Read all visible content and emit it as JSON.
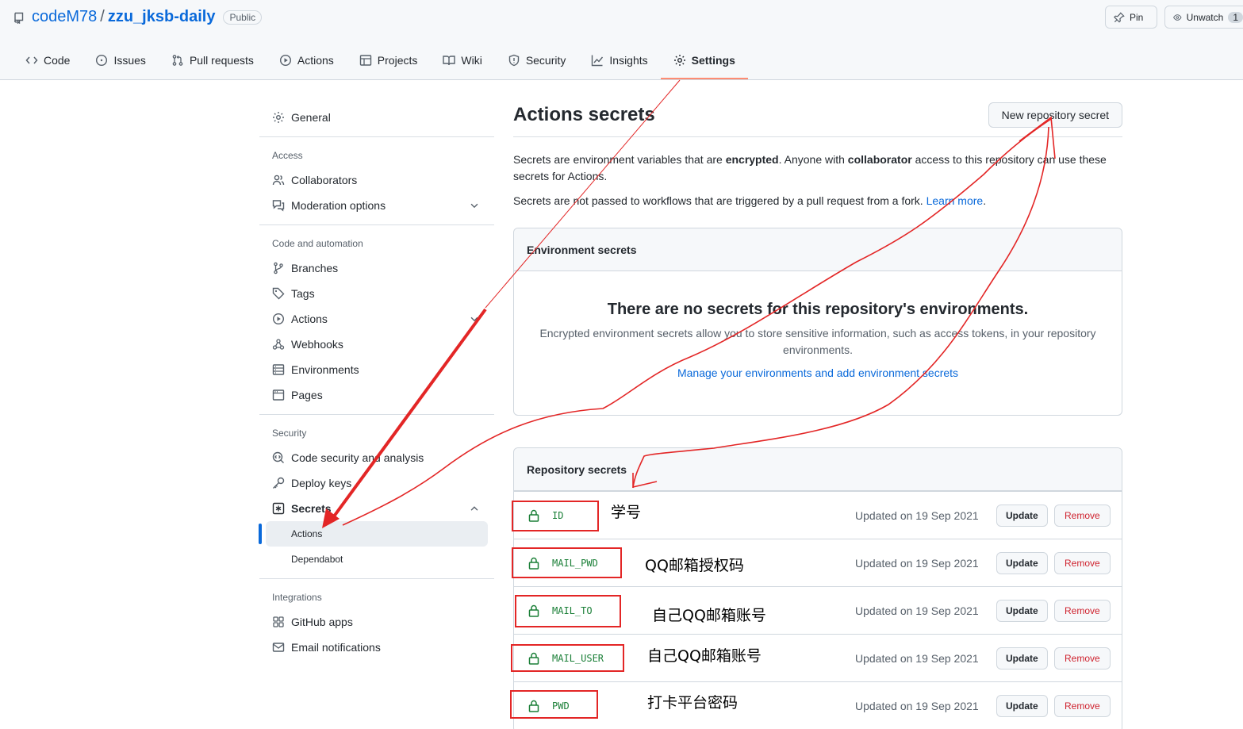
{
  "repo": {
    "owner": "codeM78",
    "separator": "/",
    "name": "zzu_jksb-daily",
    "visibility": "Public",
    "pin_label": "Pin",
    "watch_label": "Unwatch",
    "watch_count": "1"
  },
  "nav": {
    "tabs": [
      {
        "label": "Code",
        "icon": "code-icon"
      },
      {
        "label": "Issues",
        "icon": "issue-icon"
      },
      {
        "label": "Pull requests",
        "icon": "pull-request-icon"
      },
      {
        "label": "Actions",
        "icon": "play-icon"
      },
      {
        "label": "Projects",
        "icon": "table-icon"
      },
      {
        "label": "Wiki",
        "icon": "book-icon"
      },
      {
        "label": "Security",
        "icon": "shield-icon"
      },
      {
        "label": "Insights",
        "icon": "graph-icon"
      },
      {
        "label": "Settings",
        "icon": "gear-icon",
        "selected": true
      }
    ]
  },
  "sidebar": {
    "general": "General",
    "access_heading": "Access",
    "collaborators": "Collaborators",
    "moderation": "Moderation options",
    "code_heading": "Code and automation",
    "branches": "Branches",
    "tags": "Tags",
    "actions": "Actions",
    "webhooks": "Webhooks",
    "environments": "Environments",
    "pages": "Pages",
    "security_heading": "Security",
    "code_security": "Code security and analysis",
    "deploy_keys": "Deploy keys",
    "secrets": "Secrets",
    "secrets_actions": "Actions",
    "secrets_dependabot": "Dependabot",
    "integrations_heading": "Integrations",
    "github_apps": "GitHub apps",
    "email_notifications": "Email notifications"
  },
  "main": {
    "title": "Actions secrets",
    "new_secret_button": "New repository secret",
    "desc1_a": "Secrets are environment variables that are ",
    "desc1_b": "encrypted",
    "desc1_c": ". Anyone with ",
    "desc1_d": "collaborator",
    "desc1_e": " access to this repository can use these secrets for Actions.",
    "desc2": "Secrets are not passed to workflows that are triggered by a pull request from a fork. ",
    "learn_more": "Learn more",
    "env_heading": "Environment secrets",
    "env_blank_title": "There are no secrets for this repository's environments.",
    "env_blank_text": "Encrypted environment secrets allow you to store sensitive information, such as access tokens, in your repository environments.",
    "env_blank_link": "Manage your environments and add environment secrets",
    "repo_heading": "Repository secrets",
    "update_label": "Update",
    "remove_label": "Remove",
    "secrets": [
      {
        "name": "ID",
        "updated": "Updated on 19 Sep 2021"
      },
      {
        "name": "MAIL_PWD",
        "updated": "Updated on 19 Sep 2021"
      },
      {
        "name": "MAIL_TO",
        "updated": "Updated on 19 Sep 2021"
      },
      {
        "name": "MAIL_USER",
        "updated": "Updated on 19 Sep 2021"
      },
      {
        "name": "PWD",
        "updated": "Updated on 19 Sep 2021"
      }
    ]
  },
  "annotations": {
    "id_note": "学号",
    "mail_pwd_note": "QQ邮箱授权码",
    "mail_to_note": "自己QQ邮箱账号",
    "mail_user_note": "自己QQ邮箱账号",
    "pwd_note": "打卡平台密码",
    "annotation_color": "#e32626"
  },
  "colors": {
    "link": "#0969da",
    "secret_name": "#1a7f37",
    "remove": "#cf222e",
    "tab_underline": "#fd8c73",
    "active_bar": "#0969da"
  }
}
